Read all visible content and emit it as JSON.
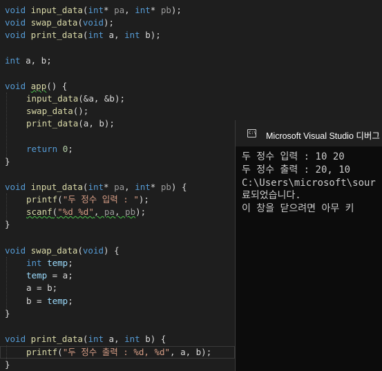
{
  "code": {
    "proto_input": [
      "void ",
      "input_data",
      "(",
      "int",
      "* ",
      "pa",
      ", ",
      "int",
      "* ",
      "pb",
      ");"
    ],
    "proto_swap": [
      "void ",
      "swap_data",
      "(",
      "void",
      ");"
    ],
    "proto_print": [
      "void ",
      "print_data",
      "(",
      "int",
      " a, ",
      "int",
      " b);"
    ],
    "globals": [
      "int",
      " a, b;"
    ],
    "app_sig": [
      "void ",
      "app",
      "() {"
    ],
    "app_call_input": [
      "input_data",
      "(&a, &b);"
    ],
    "app_call_swap": [
      "swap_data",
      "();"
    ],
    "app_call_print": [
      "print_data",
      "(a, b);"
    ],
    "app_return": [
      "return ",
      "0",
      ";"
    ],
    "close_brace": "}",
    "def_input_sig": [
      "void ",
      "input_data",
      "(",
      "int",
      "* ",
      "pa",
      ", ",
      "int",
      "* ",
      "pb",
      ") {"
    ],
    "def_input_printf": [
      "printf",
      "(",
      "\"두 정수 입력 : \"",
      ");"
    ],
    "def_input_scanf": [
      "scanf",
      "(",
      "\"%d %d\"",
      ", ",
      "pa",
      ", ",
      "pb",
      ");"
    ],
    "def_swap_sig": [
      "void ",
      "swap_data",
      "(",
      "void",
      ") {"
    ],
    "def_swap_decl": [
      "int ",
      "temp",
      ";"
    ],
    "def_swap_l1": [
      "temp",
      " = a;"
    ],
    "def_swap_l2": [
      "a = b;"
    ],
    "def_swap_l3": [
      "b = ",
      "temp",
      ";"
    ],
    "def_print_sig": [
      "void ",
      "print_data",
      "(",
      "int",
      " a, ",
      "int",
      " b) {"
    ],
    "def_print_printf": [
      "printf",
      "(",
      "\"두 정수 출력 : %d, %d\"",
      ", a, b);"
    ]
  },
  "console": {
    "title": "Microsoft Visual Studio 디버그",
    "icon_label": "C:\\",
    "lines": [
      "두 정수 입력 : 10 20",
      "두 정수 출력 : 20, 10",
      "C:\\Users\\microsoft\\sour",
      "료되었습니다.",
      "이 창을 닫으려면 아무 키"
    ]
  }
}
